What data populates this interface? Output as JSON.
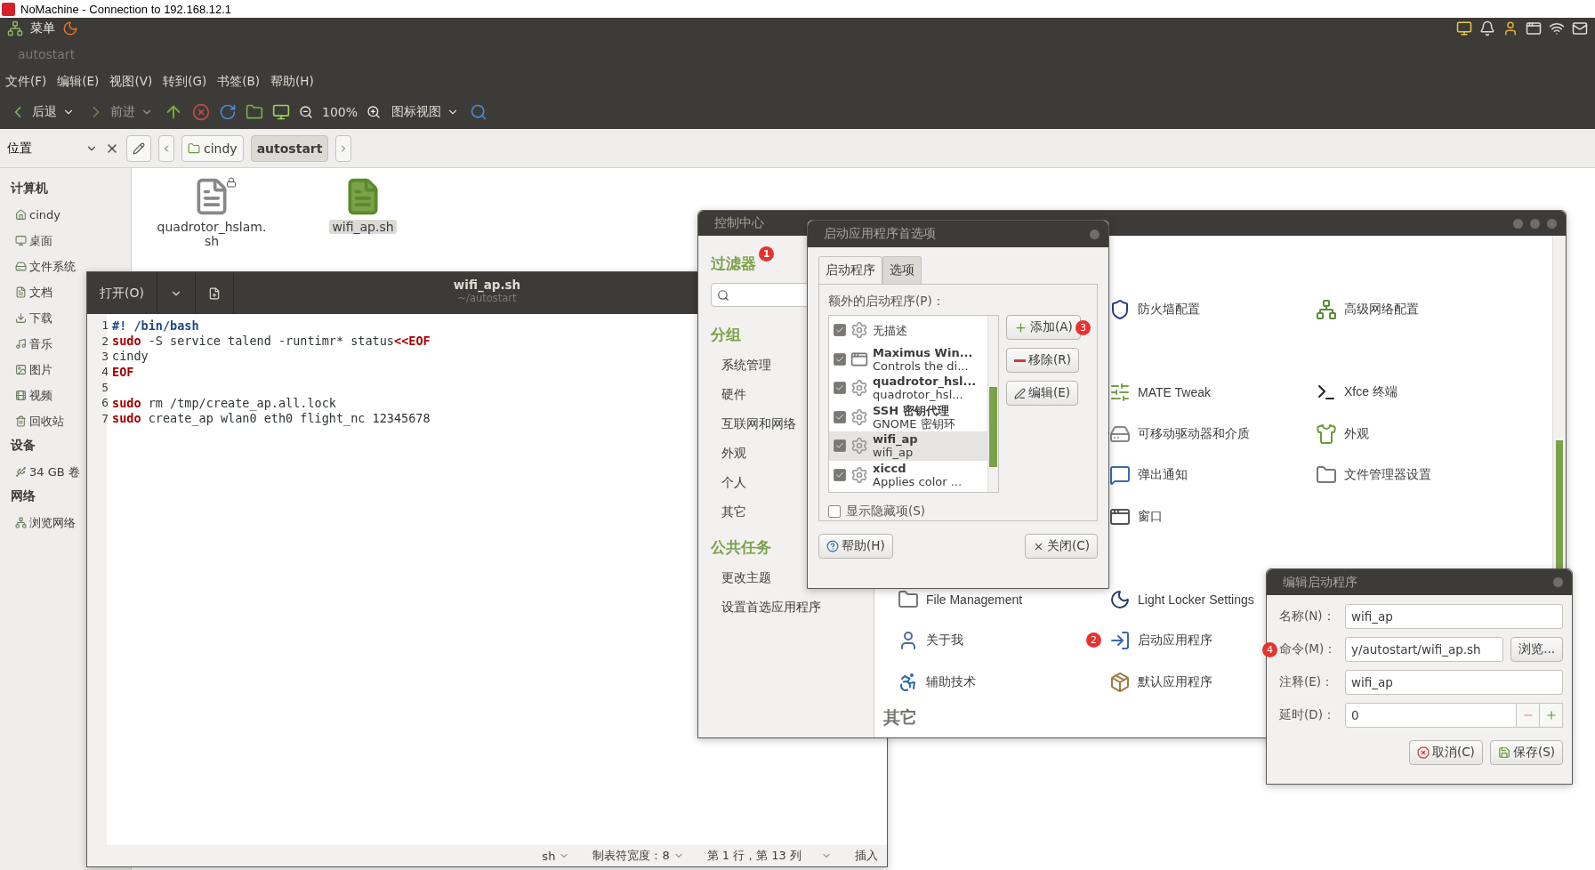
{
  "nomachine_title": "NoMachine - Connection to 192.168.12.1",
  "top_panel": {
    "menu": "菜单"
  },
  "file_manager": {
    "title": "autostart",
    "menu": [
      "文件(F)",
      "编辑(E)",
      "视图(V)",
      "转到(G)",
      "书签(B)",
      "帮助(H)"
    ],
    "toolbar": {
      "back": "后退",
      "forward": "前进",
      "zoom": "100%",
      "view": "图标视图"
    },
    "location": {
      "label": "位置",
      "path": [
        {
          "label": "cindy",
          "selected": false
        },
        {
          "label": "autostart",
          "selected": true
        }
      ]
    },
    "sidebar": [
      {
        "heading": "计算机",
        "items": [
          {
            "label": "cindy",
            "kind": "home"
          },
          {
            "label": "桌面",
            "kind": "desktop"
          },
          {
            "label": "文件系统",
            "kind": "drive"
          },
          {
            "label": "文档",
            "kind": "docs"
          },
          {
            "label": "下载",
            "kind": "download"
          },
          {
            "label": "音乐",
            "kind": "music"
          },
          {
            "label": "图片",
            "kind": "pictures"
          },
          {
            "label": "视频",
            "kind": "video"
          },
          {
            "label": "回收站",
            "kind": "trash"
          }
        ]
      },
      {
        "heading": "设备",
        "items": [
          {
            "label": "34 GB 卷",
            "kind": "usb"
          }
        ]
      },
      {
        "heading": "网络",
        "items": [
          {
            "label": "浏览网络",
            "kind": "network"
          }
        ]
      }
    ],
    "files": [
      {
        "name": "quadrotor_hslam.sh",
        "kind": "text",
        "selected": false,
        "locked": true
      },
      {
        "name": "wifi_ap.sh",
        "kind": "script",
        "selected": true
      }
    ]
  },
  "editor": {
    "open": "打开(O)",
    "title": "wifi_ap.sh",
    "subtitle": "~/autostart",
    "lines": [
      {
        "number": "1",
        "segments": [
          {
            "text": "#! /bin/bash",
            "kind": "comment"
          }
        ]
      },
      {
        "number": "2",
        "segments": [
          {
            "text": "sudo",
            "kind": "keyword"
          },
          {
            "text": " -S service talend -runtimr* status",
            "kind": "plain"
          },
          {
            "text": "<<EOF",
            "kind": "keyword"
          }
        ]
      },
      {
        "number": "3",
        "segments": [
          {
            "text": "cindy",
            "kind": "plain"
          }
        ]
      },
      {
        "number": "4",
        "segments": [
          {
            "text": "EOF",
            "kind": "keyword"
          }
        ]
      },
      {
        "number": "5"
      },
      {
        "number": "6",
        "segments": [
          {
            "text": "sudo",
            "kind": "keyword"
          },
          {
            "text": " rm /tmp/create_ap.all.lock",
            "kind": "plain"
          }
        ]
      },
      {
        "number": "7",
        "segments": [
          {
            "text": "sudo",
            "kind": "keyword"
          },
          {
            "text": " create_ap wlan0 eth0 flight_nc 12345678",
            "kind": "plain"
          }
        ]
      }
    ],
    "status": {
      "language": "sh",
      "tab_width": "制表符宽度：8",
      "position": "第 1 行，第 13 列",
      "mode": "插入"
    }
  },
  "control_center": {
    "title": "控制中心",
    "filter_heading": "过滤器",
    "filter_badge": "1",
    "groups_heading": "分组",
    "groups": [
      "系统管理",
      "硬件",
      "互联网和网络",
      "外观",
      "个人",
      "其它"
    ],
    "tasks_heading": "公共任务",
    "tasks": [
      "更改主题",
      "设置首选应用程序"
    ],
    "rows": [
      [
        null,
        {
          "label": "防火墙配置"
        },
        {
          "label": "高级网络配置"
        }
      ],
      [
        null,
        null,
        null
      ],
      [
        null,
        {
          "label": "MATE Tweak"
        },
        {
          "label": "Xfce 终端"
        }
      ],
      [
        null,
        {
          "label": "可移动驱动器和介质"
        },
        {
          "label": "外观"
        }
      ],
      [
        null,
        {
          "label": "弹出通知"
        },
        {
          "label": "文件管理器设置"
        }
      ],
      [
        null,
        {
          "label": "窗口"
        },
        null
      ],
      [
        null,
        null,
        null
      ],
      [
        {
          "label": "File Management"
        },
        {
          "label": "Light Locker Settings"
        },
        null
      ],
      [
        {
          "label": "关于我"
        },
        {
          "label": "启动应用程序",
          "badge": "2"
        },
        null
      ],
      [
        {
          "label": "辅助技术"
        },
        {
          "label": "默认应用程序"
        },
        null
      ]
    ],
    "other_heading": "其它"
  },
  "startup_prefs": {
    "title": "启动应用程序首选项",
    "tabs": [
      {
        "label": "启动程序",
        "selected": true
      },
      {
        "label": "选项",
        "selected": false
      }
    ],
    "list_label": "额外的启动程序(P)：",
    "programs": [
      {
        "description": "无描述",
        "checked": true,
        "selected": false
      },
      {
        "name": "Maximus Win...",
        "description": "Controls the di...",
        "checked": true,
        "selected": false
      },
      {
        "name": "quadrotor_hsl...",
        "description": "quadrotor_hsl...",
        "checked": true,
        "selected": false
      },
      {
        "name": "SSH 密钥代理",
        "description": "GNOME 密钥环",
        "checked": true,
        "selected": false
      },
      {
        "name": "wifi_ap",
        "description": "wifi_ap",
        "checked": true,
        "selected": true
      },
      {
        "name": "xiccd",
        "description": "Applies color ...",
        "checked": true,
        "selected": false
      }
    ],
    "buttons": [
      {
        "label": "添加(A)",
        "kind": "add",
        "badge": "3"
      },
      {
        "label": "移除(R)",
        "kind": "remove"
      },
      {
        "label": "编辑(E)",
        "kind": "edit"
      }
    ],
    "show_hidden": {
      "label": "显示隐藏项(S)",
      "checked": false
    },
    "help": "帮助(H)",
    "close": "关闭(C)"
  },
  "edit_dialog": {
    "title": "编辑启动程序",
    "fields": [
      {
        "label": "名称(N)：",
        "value": "wifi_ap",
        "kind": "text"
      },
      {
        "label": "命令(M)：",
        "value": "y/autostart/wifi_ap.sh",
        "kind": "browse",
        "button": "浏览...",
        "badge": "4"
      },
      {
        "label": "注释(E)：",
        "value": "wifi_ap",
        "kind": "text"
      },
      {
        "label": "延时(D)：",
        "value": "0",
        "kind": "spin"
      }
    ],
    "cancel": "取消(C)",
    "save": "保存(S)"
  }
}
